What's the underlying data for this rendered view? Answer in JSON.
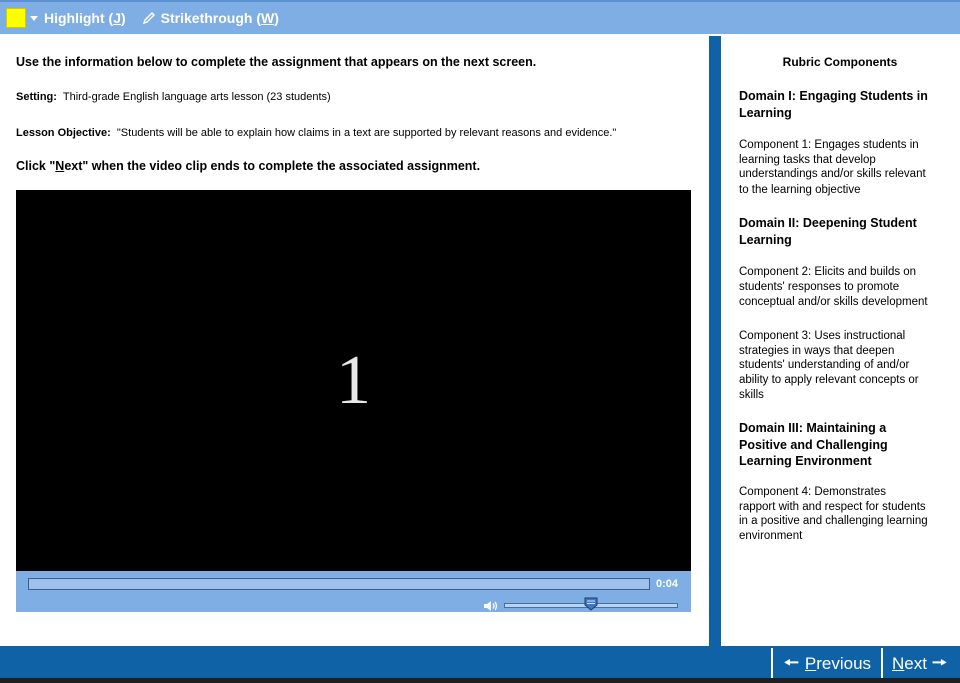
{
  "toolbar": {
    "highlight_label": "Highlight (",
    "highlight_key": "J",
    "highlight_close": ")",
    "strike_label": "Strikethrough (",
    "strike_key": "W",
    "strike_close": ")",
    "highlight_color": "#ffff00"
  },
  "main": {
    "instruction": "Use the information below to complete the assignment that appears on the next screen.",
    "setting_label": "Setting:",
    "setting_value": "Third-grade English language arts lesson (23 students)",
    "objective_label": "Lesson Objective:",
    "objective_value": "\"Students will be able to explain how claims in a text are supported by relevant reasons and evidence.\"",
    "click_prefix": "Click \"",
    "click_key": "N",
    "click_rest": "ext\" when the video clip ends to complete the associated assignment."
  },
  "video": {
    "frame_text": "1",
    "time": "0:04",
    "progress": 0,
    "volume": 0.5
  },
  "rubric": {
    "title": "Rubric Components",
    "domain1_line1": "Domain I:  Engaging Students in",
    "domain1_line2": "Learning",
    "comp1": [
      "Component 1:  Engages students in",
      "learning tasks that develop",
      "understandings and/or skills relevant",
      "to the learning objective"
    ],
    "domain2_line1": "Domain II:  Deepening Student",
    "domain2_line2": "Learning",
    "comp2": [
      "Component 2:  Elicits and builds on",
      "students' responses to promote",
      "conceptual and/or skills development"
    ],
    "comp3": [
      "Component 3:  Uses instructional",
      "strategies in ways that deepen",
      "students' understanding of and/or",
      "ability to apply relevant concepts or",
      "skills"
    ],
    "domain3_line1": "Domain III:  Maintaining a",
    "domain3_line2": "Positive and Challenging",
    "domain3_line3": "Learning Environment",
    "comp4": [
      "Component 4:  Demonstrates",
      "rapport with and respect for students",
      "in a positive and challenging learning",
      "environment"
    ]
  },
  "footer": {
    "previous_key": "P",
    "previous_rest": "revious",
    "next_key": "N",
    "next_rest": "ext",
    "accent_color": "#1062a6"
  }
}
